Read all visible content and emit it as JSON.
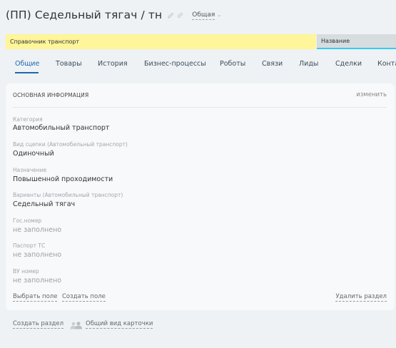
{
  "header": {
    "title": "(ПП) Седельный тягач / тн",
    "view_dropdown": "Общая",
    "caret": "⌄"
  },
  "breadcrumb": {
    "left": "Справочник транспорт",
    "right": "Название"
  },
  "tabs": [
    "Общие",
    "Товары",
    "История",
    "Бизнес-процессы",
    "Роботы",
    "Связи",
    "Лиды",
    "Сделки",
    "Конта"
  ],
  "card": {
    "title": "ОСНОВНАЯ ИНФОРМАЦИЯ",
    "edit_label": "изменить",
    "fields": [
      {
        "label": "Категория",
        "value": "Автомобильный транспорт"
      },
      {
        "label": "Вид сцепки (Автомобильный транспорт)",
        "value": "Одиночный"
      },
      {
        "label": "Назначение",
        "value": "Повышенной проходимости"
      },
      {
        "label": "Варианты (Автомобильный транспорт)",
        "value": "Седельный тягач"
      },
      {
        "label": "Гос.номер",
        "value": "не заполнено"
      },
      {
        "label": "Паспорт ТС",
        "value": "не заполнено"
      },
      {
        "label": "ВУ номер",
        "value": "не заполнено"
      }
    ],
    "select_field": "Выбрать поле",
    "create_field": "Создать поле",
    "delete_section": "Удалить раздел"
  },
  "footer": {
    "create_section": "Создать раздел",
    "common_view": "Общий вид карточки"
  },
  "colors": {
    "accent": "#2067b0",
    "breadcrumb_yellow": "#fff59a",
    "breadcrumb_gray": "#d7dcdf",
    "underline_cyan": "#3bc8f5"
  }
}
